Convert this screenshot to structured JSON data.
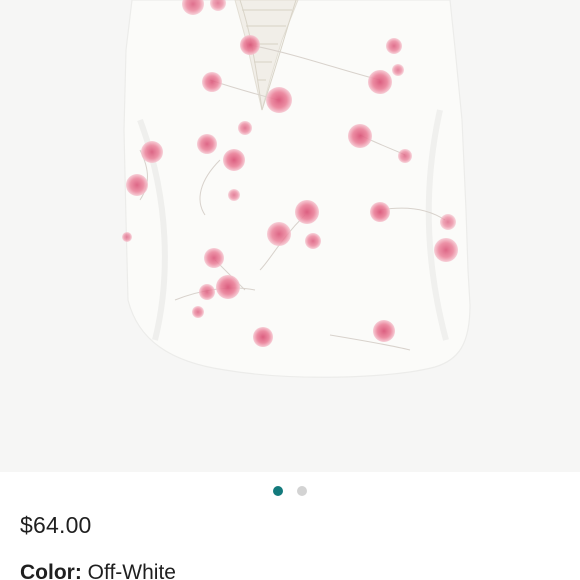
{
  "product": {
    "image_alt": "Off-white sleeveless top with pink floral print and lace neckline",
    "background_color": "#f6f6f5",
    "garment_color": "#fbfbf9",
    "flower_color": "#e06b86"
  },
  "carousel": {
    "active_index": 0,
    "total": 2,
    "active_color": "#137a7c",
    "inactive_color": "#d3d3d3"
  },
  "details": {
    "price": "$64.00",
    "color_label": "Color:",
    "color_value": "Off-White"
  }
}
